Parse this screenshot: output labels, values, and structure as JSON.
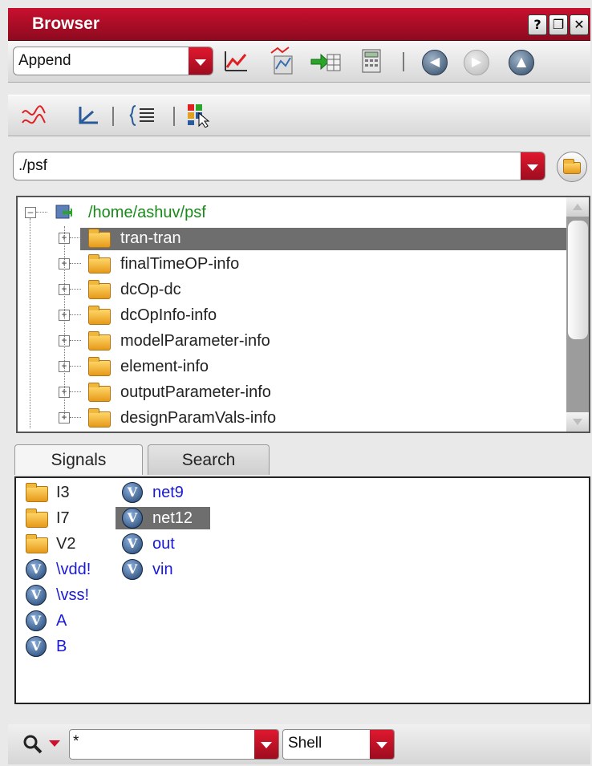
{
  "window": {
    "title": "Browser",
    "buttons": [
      "?",
      "❐",
      "✕"
    ]
  },
  "toolbar1": {
    "mode_value": "Append"
  },
  "path": {
    "value": "./psf"
  },
  "tree": {
    "root": "/home/ashuv/psf",
    "items": [
      {
        "label": "tran-tran",
        "selected": true
      },
      {
        "label": "finalTimeOP-info",
        "selected": false
      },
      {
        "label": "dcOp-dc",
        "selected": false
      },
      {
        "label": "dcOpInfo-info",
        "selected": false
      },
      {
        "label": "modelParameter-info",
        "selected": false
      },
      {
        "label": "element-info",
        "selected": false
      },
      {
        "label": "outputParameter-info",
        "selected": false
      },
      {
        "label": "designParamVals-info",
        "selected": false
      }
    ]
  },
  "tabs": [
    {
      "label": "Signals",
      "active": true
    },
    {
      "label": "Search",
      "active": false
    }
  ],
  "signals": {
    "col1": [
      {
        "label": "I3",
        "kind": "folder"
      },
      {
        "label": "I7",
        "kind": "folder"
      },
      {
        "label": "V2",
        "kind": "folder"
      },
      {
        "label": "\\vdd!",
        "kind": "signal"
      },
      {
        "label": "\\vss!",
        "kind": "signal"
      },
      {
        "label": "A",
        "kind": "signal"
      },
      {
        "label": "B",
        "kind": "signal"
      }
    ],
    "col2": [
      {
        "label": "net9",
        "kind": "signal",
        "selected": false
      },
      {
        "label": "net12",
        "kind": "signal",
        "selected": true
      },
      {
        "label": "out",
        "kind": "signal",
        "selected": false
      },
      {
        "label": "vin",
        "kind": "signal",
        "selected": false
      }
    ],
    "signal_glyph": "V"
  },
  "bottom": {
    "filter_value": "*",
    "shell_value": "Shell"
  },
  "colors": {
    "title_bg": "#b00d26",
    "selection_bg": "#6e6e6e",
    "signal_text": "#1a1ad6",
    "root_text": "#1a8a1a"
  }
}
